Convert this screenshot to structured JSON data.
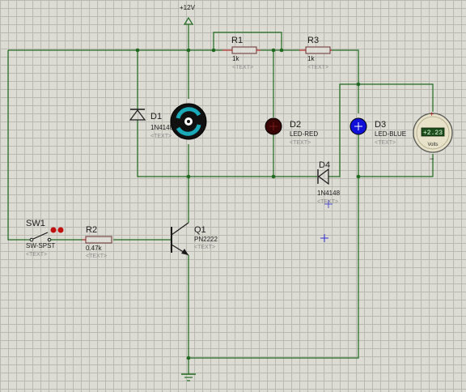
{
  "power": {
    "label": "+12V"
  },
  "components": {
    "r1": {
      "ref": "R1",
      "value": "1k",
      "text": "<TEXT>"
    },
    "r3": {
      "ref": "R3",
      "value": "1k",
      "text": "<TEXT>"
    },
    "r2": {
      "ref": "R2",
      "value": "0.47k",
      "text": "<TEXT>"
    },
    "d1": {
      "ref": "D1",
      "value": "1N4148",
      "text": "<TEXT>"
    },
    "d2": {
      "ref": "D2",
      "value": "LED-RED",
      "text": "<TEXT>"
    },
    "d3": {
      "ref": "D3",
      "value": "LED-BLUE",
      "text": "<TEXT>"
    },
    "d4": {
      "ref": "D4",
      "value": "1N4148",
      "text": "<TEXT>"
    },
    "q1": {
      "ref": "Q1",
      "value": "PN2222",
      "text": "<TEXT>"
    },
    "sw1": {
      "ref": "SW1",
      "value": "SW-SPST",
      "text": "<TEXT>"
    }
  },
  "voltmeter": {
    "reading": "+2.23",
    "unit": "Volts",
    "plus": "+",
    "minus": "−"
  },
  "colors": {
    "wire": "#1f6a1f",
    "led_red": "#3a0505",
    "led_blue": "#1010d8",
    "motor_accent": "#19a9b8",
    "meter_display": "#1c4f1c",
    "grid": "#b9b9b1"
  },
  "icons": {
    "motor": "motor-icon",
    "ground": "ground-icon",
    "power": "power-terminal-icon",
    "voltmeter": "voltmeter-icon",
    "cursor": "crosshair-cursor-icon"
  }
}
